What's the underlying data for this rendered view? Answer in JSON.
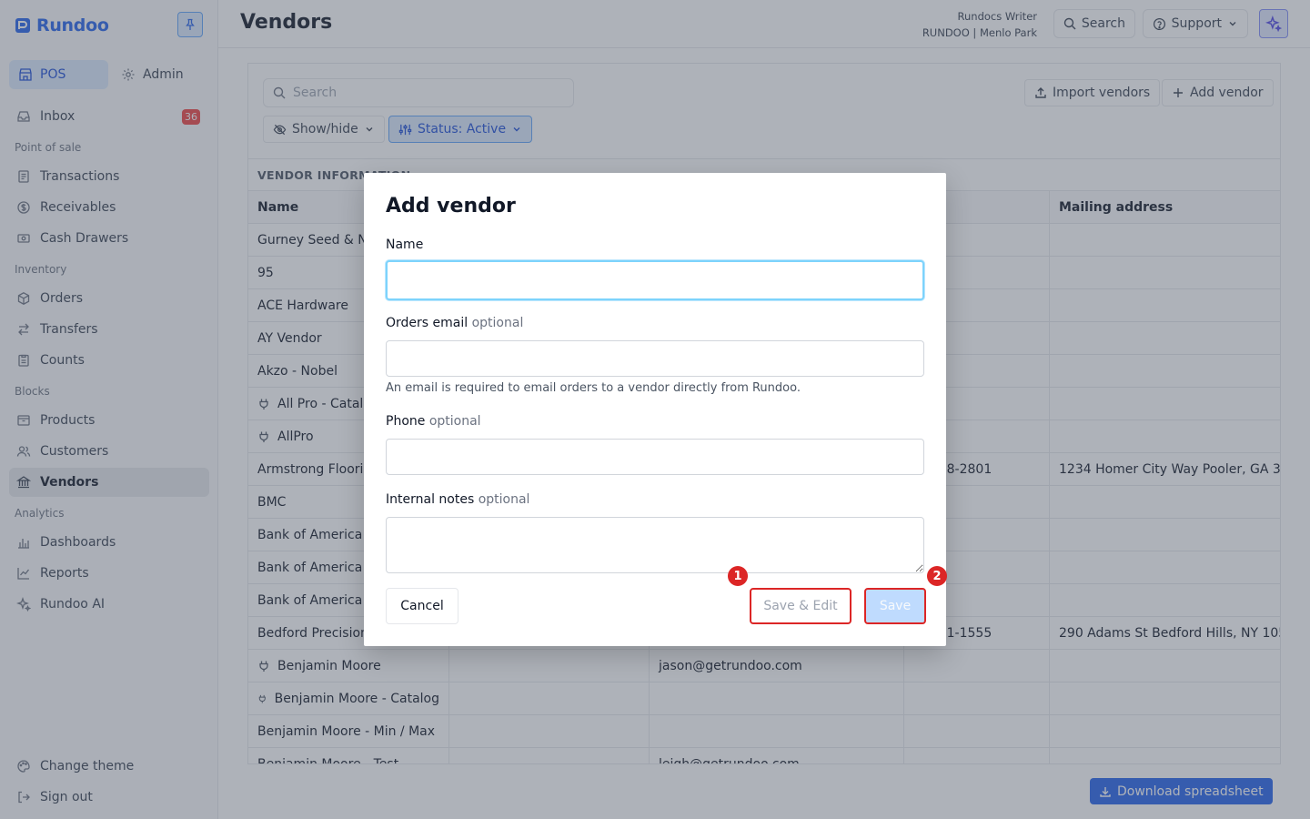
{
  "app": {
    "logo_text": "Rundoo",
    "page_title": "Vendors",
    "account_name": "Rundocs Writer",
    "account_location": "RUNDOO | Menlo Park",
    "search_label": "Search",
    "support_label": "Support"
  },
  "sidebar": {
    "modes": [
      {
        "label": "POS",
        "icon": "store-icon",
        "active": true
      },
      {
        "label": "Admin",
        "icon": "gear-icon",
        "active": false
      }
    ],
    "inbox": {
      "label": "Inbox",
      "badge": "36"
    },
    "sections": [
      {
        "title": "Point of sale",
        "items": [
          "Transactions",
          "Receivables",
          "Cash Drawers"
        ]
      },
      {
        "title": "Inventory",
        "items": [
          "Orders",
          "Transfers",
          "Counts"
        ]
      },
      {
        "title": "Blocks",
        "items": [
          "Products",
          "Customers",
          "Vendors"
        ]
      },
      {
        "title": "Analytics",
        "items": [
          "Dashboards",
          "Reports",
          "Rundoo AI"
        ]
      }
    ],
    "active_item": "Vendors",
    "bottom": [
      "Change theme",
      "Sign out"
    ]
  },
  "toolbar": {
    "search_placeholder": "Search",
    "import_label": "Import vendors",
    "add_label": "Add vendor",
    "show_hide_label": "Show/hide",
    "status_filter_label": "Status: Active"
  },
  "table": {
    "group_title": "VENDOR INFORMATION",
    "columns": [
      "Name",
      "",
      "",
      "e",
      "Mailing address"
    ],
    "rows": [
      {
        "name": "Gurney Seed & Nur",
        "plug": false,
        "email": "",
        "phone": "",
        "address": ""
      },
      {
        "name": "95",
        "plug": false,
        "email": "",
        "phone": "",
        "address": ""
      },
      {
        "name": "ACE Hardware",
        "plug": false,
        "email": "",
        "phone": "",
        "address": ""
      },
      {
        "name": "AY Vendor",
        "plug": false,
        "email": "",
        "phone": "",
        "address": ""
      },
      {
        "name": "Akzo - Nobel",
        "plug": false,
        "email": "",
        "phone": "",
        "address": ""
      },
      {
        "name": "All Pro - Catalo",
        "plug": true,
        "email": "",
        "phone": "",
        "address": ""
      },
      {
        "name": "AllPro",
        "plug": true,
        "email": "",
        "phone": "",
        "address": ""
      },
      {
        "name": "Armstrong Flooring",
        "plug": false,
        "email": "",
        "phone": "2) 658-2801",
        "address": "1234 Homer City Way Pooler, GA 31322"
      },
      {
        "name": "BMC",
        "plug": false,
        "email": "",
        "phone": "",
        "address": ""
      },
      {
        "name": "Bank of America (S",
        "plug": false,
        "email": "",
        "phone": "",
        "address": ""
      },
      {
        "name": "Bank of America (S",
        "plug": false,
        "email": "",
        "phone": "",
        "address": ""
      },
      {
        "name": "Bank of America (t",
        "plug": false,
        "email": "",
        "phone": "",
        "address": ""
      },
      {
        "name": "Bedford Precision P",
        "plug": false,
        "email": "",
        "phone": "0) 431-1555",
        "address": "290 Adams St Bedford Hills, NY 10507"
      },
      {
        "name": "Benjamin Moore",
        "plug": true,
        "email": "jason@getrundoo.com",
        "phone": "",
        "address": ""
      },
      {
        "name": "Benjamin Moore - Catalog",
        "plug": true,
        "email": "",
        "phone": "",
        "address": ""
      },
      {
        "name": "Benjamin Moore - Min / Max",
        "plug": false,
        "email": "",
        "phone": "",
        "address": ""
      },
      {
        "name": "Benjamin Moore - Test",
        "plug": false,
        "email": "leigh@getrundoo.com",
        "phone": "",
        "address": ""
      }
    ]
  },
  "footer": {
    "download_label": "Download spreadsheet"
  },
  "modal": {
    "title": "Add vendor",
    "name_label": "Name",
    "name_value": "",
    "email_label": "Orders email",
    "email_value": "",
    "email_hint": "An email is required to email orders to a vendor directly from Rundoo.",
    "phone_label": "Phone",
    "phone_value": "",
    "notes_label": "Internal notes",
    "notes_value": "",
    "optional_text": "optional",
    "cancel_label": "Cancel",
    "save_edit_label": "Save & Edit",
    "save_label": "Save",
    "markers": [
      "1",
      "2"
    ]
  },
  "colors": {
    "brand": "#2563eb",
    "highlight": "#dc2626",
    "focus_ring": "#7dd3fc",
    "badge": "#ef4444"
  }
}
